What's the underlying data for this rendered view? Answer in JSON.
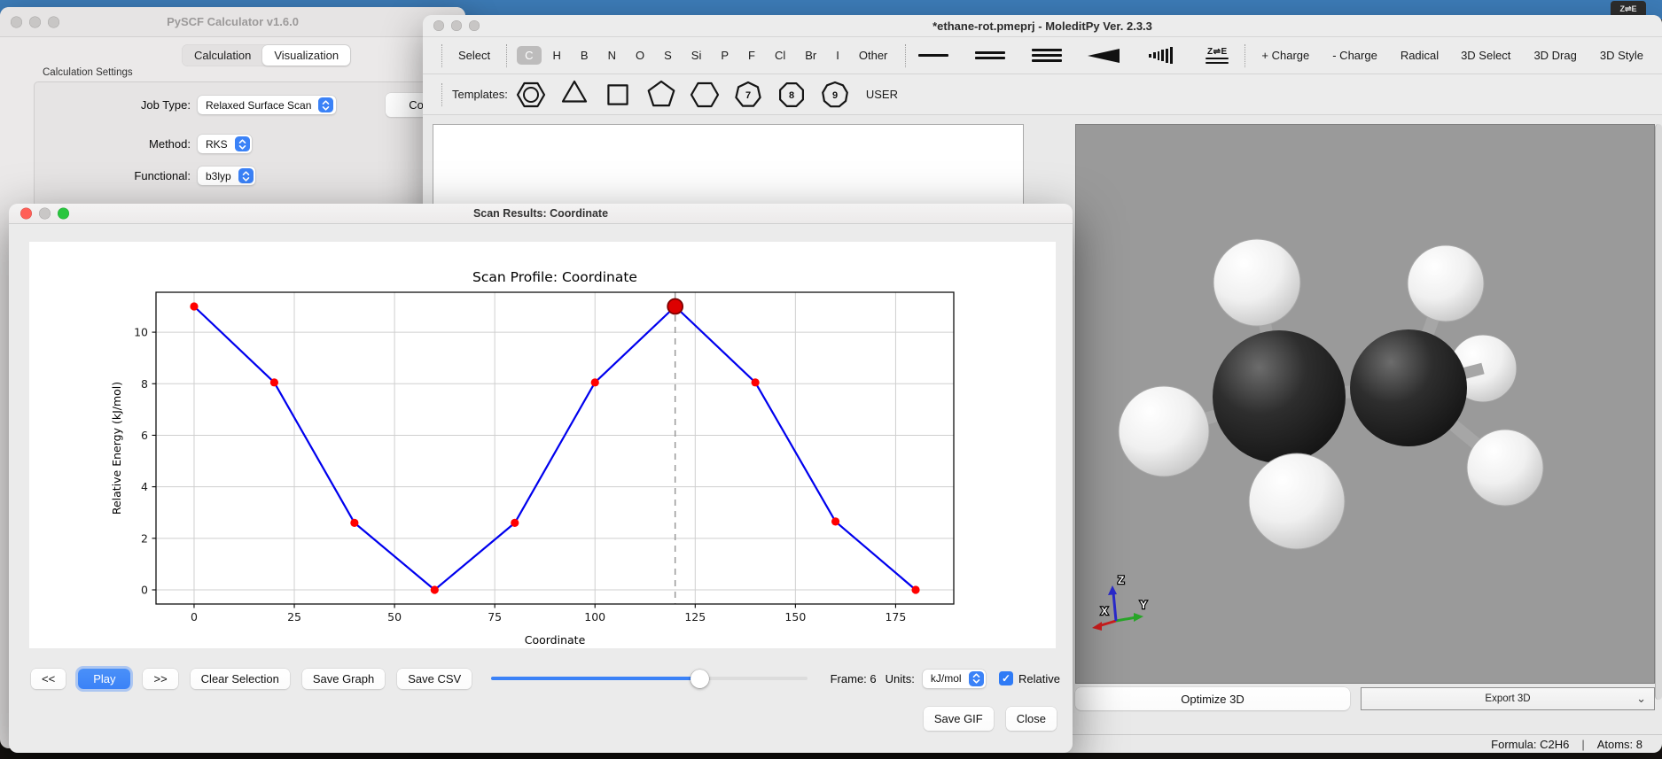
{
  "desktop": {
    "menubar_badge": "Z⇌E"
  },
  "colors": {
    "accent_blue": "#3b82f7",
    "viewer_background": "#9a9a9a",
    "carbon": "#2a2a2a",
    "hydrogen": "#f2f2f2"
  },
  "pyscf_window": {
    "title": "PySCF Calculator v1.6.0",
    "tabs": [
      {
        "label": "Calculation"
      },
      {
        "label": "Visualization"
      }
    ],
    "active_tab": "Visualization",
    "settings_group": "Calculation Settings",
    "fields": [
      {
        "label": "Job Type:",
        "value": "Relaxed Surface Scan"
      },
      {
        "label": "Method:",
        "value": "RKS"
      },
      {
        "label": "Functional:",
        "value": "b3lyp"
      }
    ],
    "config_button": "Config"
  },
  "moledit_window": {
    "title": "*ethane-rot.pmeprj - MoleditPy Ver. 2.3.3",
    "toolbar": {
      "select_button": "Select",
      "elements": [
        "C",
        "H",
        "B",
        "N",
        "O",
        "S",
        "Si",
        "P",
        "F",
        "Cl",
        "Br",
        "I",
        "Other"
      ],
      "selected_element": "C",
      "bond_icons": [
        "single-bond",
        "double-bond",
        "triple-bond",
        "wedge-bond",
        "hash-wedge-bond",
        "ez-bond"
      ],
      "ez_label": "Z⇌E",
      "charge_buttons": [
        "+ Charge",
        "- Charge",
        "Radical"
      ],
      "right_buttons": [
        "3D Select",
        "3D Drag",
        "3D Style"
      ]
    },
    "templates": {
      "label": "Templates:",
      "rings": [
        "benzene",
        "3",
        "4",
        "5",
        "6",
        "7",
        "8",
        "9"
      ],
      "user_button": "USER"
    },
    "viewer": {
      "optimize_button": "Optimize 3D",
      "export_select": "Export 3D",
      "axis_x": "X",
      "axis_y": "Y",
      "axis_z": "Z"
    },
    "statusbar": {
      "formula": "Formula: C2H6",
      "divider": "|",
      "atoms": "Atoms: 8"
    }
  },
  "scan_window": {
    "title": "Scan Results: Coordinate",
    "controls": {
      "prev": "<<",
      "play": "Play",
      "next": ">>",
      "clear": "Clear Selection",
      "save_graph": "Save Graph",
      "save_csv": "Save CSV",
      "frame_label": "Frame: 6",
      "units_label": "Units:",
      "units_value": "kJ/mol",
      "relative_label": "Relative",
      "relative_checked": true,
      "slider_fraction": 0.66
    },
    "footer": {
      "save_gif": "Save GIF",
      "close": "Close"
    }
  },
  "chart_data": {
    "type": "line",
    "title": "Scan Profile: Coordinate",
    "xlabel": "Coordinate",
    "ylabel": "Relative Energy (kJ/mol)",
    "x": [
      0,
      20,
      40,
      60,
      80,
      100,
      120,
      140,
      160,
      180
    ],
    "y": [
      11.0,
      8.05,
      2.6,
      0.0,
      2.6,
      8.05,
      11.0,
      8.05,
      2.65,
      0.0
    ],
    "xticks": [
      0,
      25,
      50,
      75,
      100,
      125,
      150,
      175
    ],
    "yticks": [
      0,
      2,
      4,
      6,
      8,
      10
    ],
    "xlim": [
      -9.5,
      189.5
    ],
    "ylim": [
      -0.55,
      11.55
    ],
    "grid": true,
    "legend": null,
    "line_color": "#0000ee",
    "marker_color": "#ff0000",
    "highlight_index": 6,
    "highlight_fill": "#dd0000",
    "highlight_edge": "#7a0000",
    "vline_color": "#999999"
  }
}
